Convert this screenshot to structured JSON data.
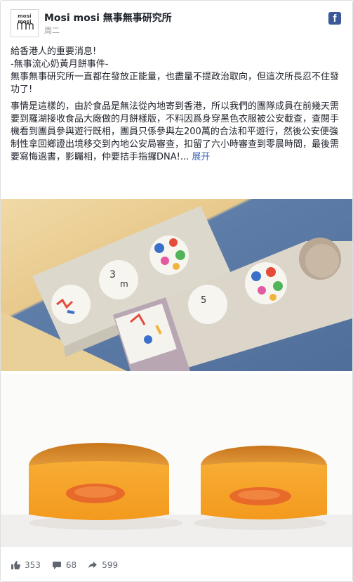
{
  "post": {
    "avatar_brand": "mosi mosi",
    "page_name": "Mosi mosi 無事無事研究所",
    "timestamp": "周二",
    "line1": "給香港人的重要消息!",
    "line2": "-無事流心奶黃月餅事件-",
    "line3": "無事無事研究所一直都在發放正能量，也盡量不提政治取向，但這次所長忍不住發功了!",
    "body": "事情是這樣的，由於食品是無法從內地寄到香港，所以我們的團隊成員在前幾天需要到羅湖接收食品大廠做的月餅樣版，不料因爲身穿黑色衣服被公安截查，查閱手機看到團員參與遊行既相，團員只係參與左200萬的合法和平遊行，然後公安便強制性拿回鄉證出境移交到內地公安局審查，扣留了六小時審查到零晨時間，最後需要寫悔過書，影矚相，仲要拮手指攞DNA!...",
    "see_more": "展开"
  },
  "stats": {
    "likes": "353",
    "comments": "68",
    "shares": "599"
  },
  "icons": {
    "facebook": "facebook-icon",
    "like": "thumbs-up-icon",
    "comment": "comment-icon",
    "share": "share-icon"
  },
  "colors": {
    "link": "#4267b2",
    "facebook_blue": "#3b5998",
    "meta_text": "#90949c"
  }
}
